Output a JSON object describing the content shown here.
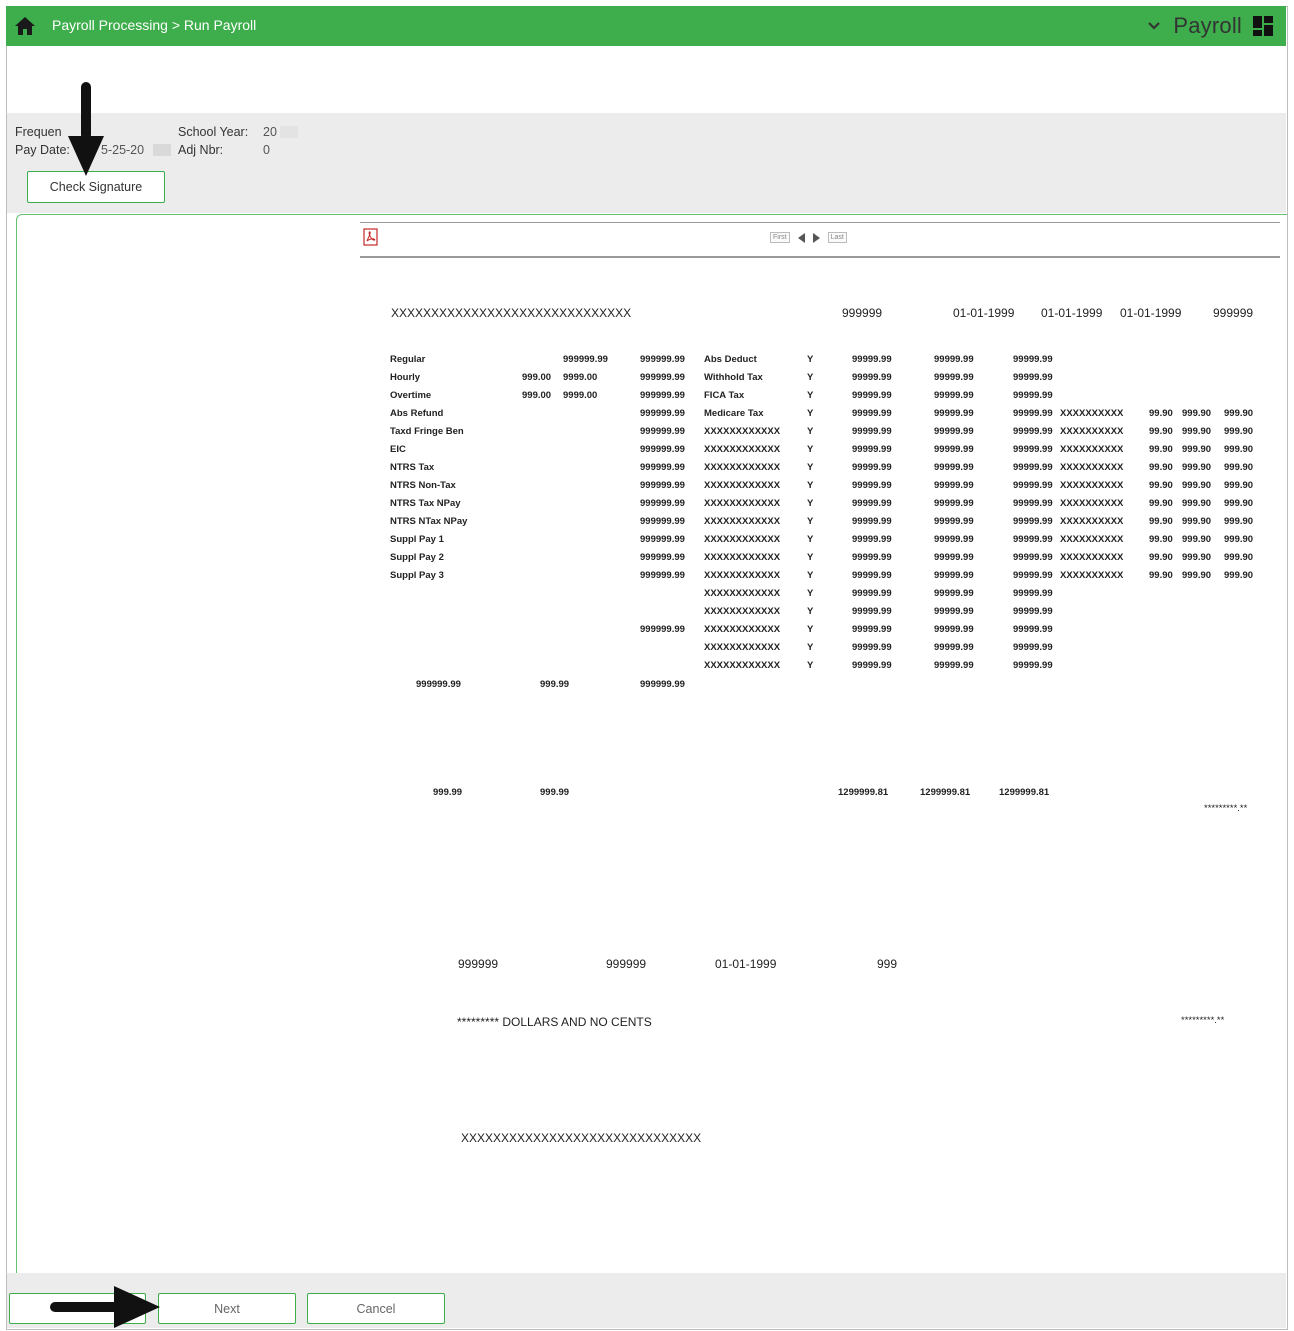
{
  "header": {
    "breadcrumb": "Payroll Processing > Run Payroll",
    "app_name": "Payroll"
  },
  "fields": {
    "frequency_label": "Frequen",
    "pay_date_label": "Pay Date:",
    "pay_date_value": "5-25-20",
    "school_year_label": "School Year:",
    "school_year_value": "20",
    "adj_nbr_label": "Adj Nbr:",
    "adj_nbr_value": "0"
  },
  "buttons": {
    "check_signature": "Check Signature",
    "next": "Next",
    "cancel": "Cancel"
  },
  "viewer": {
    "first": "First",
    "last": "Last"
  },
  "report": {
    "header_row": [
      "XXXXXXXXXXXXXXXXXXXXXXXXXXXXXX",
      "999999",
      "01-01-1999",
      "01-01-1999",
      "01-01-1999",
      "999999"
    ],
    "earnings": [
      {
        "label": "Regular",
        "hours": "",
        "rate": "999999.99",
        "amount": "999999.99"
      },
      {
        "label": "Hourly",
        "hours": "999.00",
        "rate": "9999.00",
        "amount": "999999.99"
      },
      {
        "label": "Overtime",
        "hours": "999.00",
        "rate": "9999.00",
        "amount": "999999.99"
      },
      {
        "label": "Abs Refund",
        "hours": "",
        "rate": "",
        "amount": "999999.99"
      },
      {
        "label": "Taxd Fringe Ben",
        "hours": "",
        "rate": "",
        "amount": "999999.99"
      },
      {
        "label": "EIC",
        "hours": "",
        "rate": "",
        "amount": "999999.99"
      },
      {
        "label": "NTRS Tax",
        "hours": "",
        "rate": "",
        "amount": "999999.99"
      },
      {
        "label": "NTRS Non-Tax",
        "hours": "",
        "rate": "",
        "amount": "999999.99"
      },
      {
        "label": "NTRS Tax NPay",
        "hours": "",
        "rate": "",
        "amount": "999999.99"
      },
      {
        "label": "NTRS NTax NPay",
        "hours": "",
        "rate": "",
        "amount": "999999.99"
      },
      {
        "label": "Suppl Pay 1",
        "hours": "",
        "rate": "",
        "amount": "999999.99"
      },
      {
        "label": "Suppl Pay 2",
        "hours": "",
        "rate": "",
        "amount": "999999.99"
      },
      {
        "label": "Suppl Pay 3",
        "hours": "",
        "rate": "",
        "amount": "999999.99"
      },
      {
        "label": "",
        "hours": "",
        "rate": "",
        "amount": ""
      },
      {
        "label": "",
        "hours": "",
        "rate": "",
        "amount": ""
      },
      {
        "label": "",
        "hours": "",
        "rate": "",
        "amount": "999999.99"
      },
      {
        "label": "",
        "hours": "",
        "rate": "",
        "amount": ""
      },
      {
        "label": "",
        "hours": "",
        "rate": "",
        "amount": ""
      }
    ],
    "deductions": [
      {
        "label": "Abs Deduct",
        "flag": "Y",
        "a": "99999.99",
        "b": "99999.99",
        "c": "99999.99",
        "x": "",
        "d": "",
        "e": "",
        "f": ""
      },
      {
        "label": "Withhold Tax",
        "flag": "Y",
        "a": "99999.99",
        "b": "99999.99",
        "c": "99999.99",
        "x": "",
        "d": "",
        "e": "",
        "f": ""
      },
      {
        "label": "FICA Tax",
        "flag": "Y",
        "a": "99999.99",
        "b": "99999.99",
        "c": "99999.99",
        "x": "",
        "d": "",
        "e": "",
        "f": ""
      },
      {
        "label": "Medicare Tax",
        "flag": "Y",
        "a": "99999.99",
        "b": "99999.99",
        "c": "99999.99",
        "x": "XXXXXXXXXX",
        "d": "99.90",
        "e": "999.90",
        "f": "999.90"
      },
      {
        "label": "XXXXXXXXXXXX",
        "flag": "Y",
        "a": "99999.99",
        "b": "99999.99",
        "c": "99999.99",
        "x": "XXXXXXXXXX",
        "d": "99.90",
        "e": "999.90",
        "f": "999.90"
      },
      {
        "label": "XXXXXXXXXXXX",
        "flag": "Y",
        "a": "99999.99",
        "b": "99999.99",
        "c": "99999.99",
        "x": "XXXXXXXXXX",
        "d": "99.90",
        "e": "999.90",
        "f": "999.90"
      },
      {
        "label": "XXXXXXXXXXXX",
        "flag": "Y",
        "a": "99999.99",
        "b": "99999.99",
        "c": "99999.99",
        "x": "XXXXXXXXXX",
        "d": "99.90",
        "e": "999.90",
        "f": "999.90"
      },
      {
        "label": "XXXXXXXXXXXX",
        "flag": "Y",
        "a": "99999.99",
        "b": "99999.99",
        "c": "99999.99",
        "x": "XXXXXXXXXX",
        "d": "99.90",
        "e": "999.90",
        "f": "999.90"
      },
      {
        "label": "XXXXXXXXXXXX",
        "flag": "Y",
        "a": "99999.99",
        "b": "99999.99",
        "c": "99999.99",
        "x": "XXXXXXXXXX",
        "d": "99.90",
        "e": "999.90",
        "f": "999.90"
      },
      {
        "label": "XXXXXXXXXXXX",
        "flag": "Y",
        "a": "99999.99",
        "b": "99999.99",
        "c": "99999.99",
        "x": "XXXXXXXXXX",
        "d": "99.90",
        "e": "999.90",
        "f": "999.90"
      },
      {
        "label": "XXXXXXXXXXXX",
        "flag": "Y",
        "a": "99999.99",
        "b": "99999.99",
        "c": "99999.99",
        "x": "XXXXXXXXXX",
        "d": "99.90",
        "e": "999.90",
        "f": "999.90"
      },
      {
        "label": "XXXXXXXXXXXX",
        "flag": "Y",
        "a": "99999.99",
        "b": "99999.99",
        "c": "99999.99",
        "x": "XXXXXXXXXX",
        "d": "99.90",
        "e": "999.90",
        "f": "999.90"
      },
      {
        "label": "XXXXXXXXXXXX",
        "flag": "Y",
        "a": "99999.99",
        "b": "99999.99",
        "c": "99999.99",
        "x": "XXXXXXXXXX",
        "d": "99.90",
        "e": "999.90",
        "f": "999.90"
      },
      {
        "label": "XXXXXXXXXXXX",
        "flag": "Y",
        "a": "99999.99",
        "b": "99999.99",
        "c": "99999.99",
        "x": "",
        "d": "",
        "e": "",
        "f": ""
      },
      {
        "label": "XXXXXXXXXXXX",
        "flag": "Y",
        "a": "99999.99",
        "b": "99999.99",
        "c": "99999.99",
        "x": "",
        "d": "",
        "e": "",
        "f": ""
      },
      {
        "label": "XXXXXXXXXXXX",
        "flag": "Y",
        "a": "99999.99",
        "b": "99999.99",
        "c": "99999.99",
        "x": "",
        "d": "",
        "e": "",
        "f": ""
      },
      {
        "label": "XXXXXXXXXXXX",
        "flag": "Y",
        "a": "99999.99",
        "b": "99999.99",
        "c": "99999.99",
        "x": "",
        "d": "",
        "e": "",
        "f": ""
      },
      {
        "label": "XXXXXXXXXXXX",
        "flag": "Y",
        "a": "99999.99",
        "b": "99999.99",
        "c": "99999.99",
        "x": "",
        "d": "",
        "e": "",
        "f": ""
      }
    ],
    "totals_row": [
      "999999.99",
      "999.99",
      "999999.99"
    ],
    "summary_row": [
      "999.99",
      "999.99",
      "1299999.81",
      "1299999.81",
      "1299999.81"
    ],
    "amount_stars_1": "*********.**",
    "check_row": [
      "999999",
      "999999",
      "01-01-1999",
      "999"
    ],
    "dollars_text": "********* DOLLARS AND NO CENTS",
    "amount_stars_2": "*********.**",
    "payee": "XXXXXXXXXXXXXXXXXXXXXXXXXXXXXX"
  }
}
